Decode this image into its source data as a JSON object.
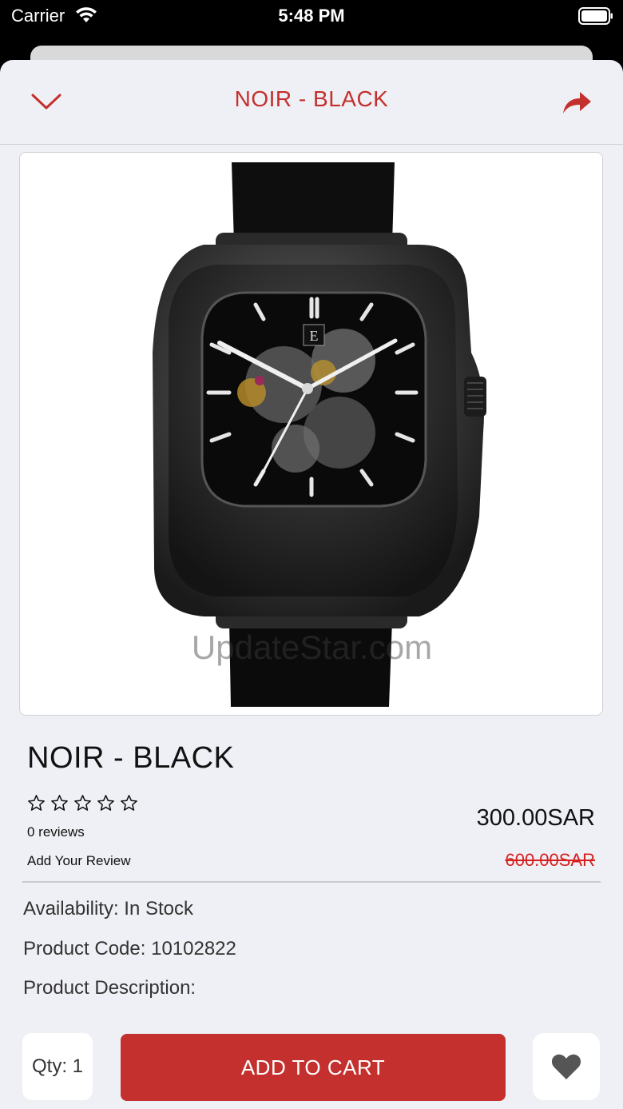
{
  "status_bar": {
    "carrier": "Carrier",
    "time": "5:48 PM"
  },
  "nav": {
    "title": "NOIR - BLACK",
    "back_icon": "chevron-down-icon",
    "share_icon": "share-icon"
  },
  "product": {
    "image_watermark": "UpdateStar.com",
    "title": "NOIR - BLACK",
    "rating_stars": 0,
    "reviews_count": "0 reviews",
    "add_review_label": "Add Your Review",
    "price": "300.00SAR",
    "old_price": "600.00SAR",
    "availability": "Availability: In Stock",
    "product_code": "Product Code: 10102822",
    "description_label": "Product Description:"
  },
  "actions": {
    "qty_label": "Qty: 1",
    "add_to_cart_label": "ADD TO CART",
    "wishlist_icon": "heart-icon"
  },
  "colors": {
    "accent": "#c3302d",
    "old_price": "#d62020",
    "background": "#eff0f5"
  }
}
